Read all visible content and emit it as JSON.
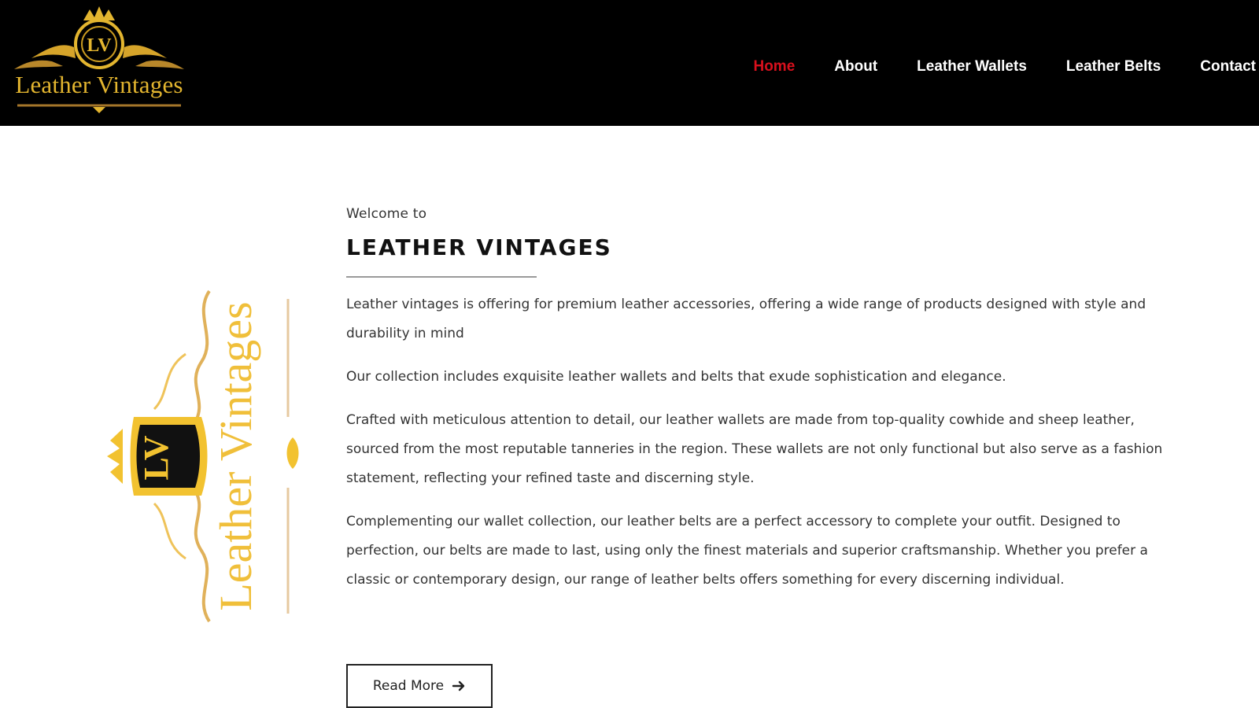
{
  "brand": {
    "name": "Leather Vintages",
    "monogram": "LV",
    "gold_color": "#e3b52f"
  },
  "nav": {
    "items": [
      {
        "label": "Home",
        "active": true
      },
      {
        "label": "About",
        "active": false
      },
      {
        "label": "Leather Wallets",
        "active": false
      },
      {
        "label": "Leather Belts",
        "active": false
      },
      {
        "label": "Contact",
        "active": false
      }
    ],
    "active_color": "#d8101d"
  },
  "side_logo": {
    "text": "Leather Vintages",
    "monogram": "LV"
  },
  "main": {
    "welcome": "Welcome to",
    "title": "LEATHER VINTAGES",
    "paragraphs": [
      "Leather  vintages is offering for premium leather accessories, offering a wide range of products designed with style and durability in mind",
      "Our collection includes exquisite leather wallets and belts that exude sophistication and elegance.",
      "Crafted with meticulous attention to detail, our leather wallets are made from top-quality cowhide and sheep leather, sourced from the most reputable tanneries in the region. These wallets are not only functional but also serve as a fashion statement, reflecting your refined taste and discerning style.",
      "Complementing our wallet collection, our leather belts are a perfect accessory to complete your outfit. Designed to perfection, our belts are made to last, using only the finest materials and superior craftsmanship. Whether you prefer a classic or contemporary design, our range of leather belts offers something for every discerning individual."
    ],
    "read_more_label": "Read More",
    "read_more_icon": "arrow-right-icon"
  }
}
